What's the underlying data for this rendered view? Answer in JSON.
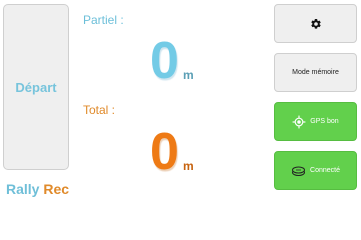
{
  "start": {
    "label": "Départ"
  },
  "brand": {
    "word1": "Rally",
    "word2": "Rec"
  },
  "partial": {
    "label": "Partiel :",
    "value": "0",
    "unit": "m"
  },
  "total": {
    "label": "Total :",
    "value": "0",
    "unit": "m"
  },
  "buttons": {
    "settings_icon": "gear-icon",
    "memory_label": "Mode mémoire",
    "gps_label": "GPS bon",
    "gps_icon": "gps-target-icon",
    "connect_label": "Connecté",
    "connect_icon": "device-icon"
  },
  "colors": {
    "partial": "#73cbe6",
    "total": "#ee7a15",
    "green_button": "#62d04c",
    "gray_button": "#efefef"
  }
}
